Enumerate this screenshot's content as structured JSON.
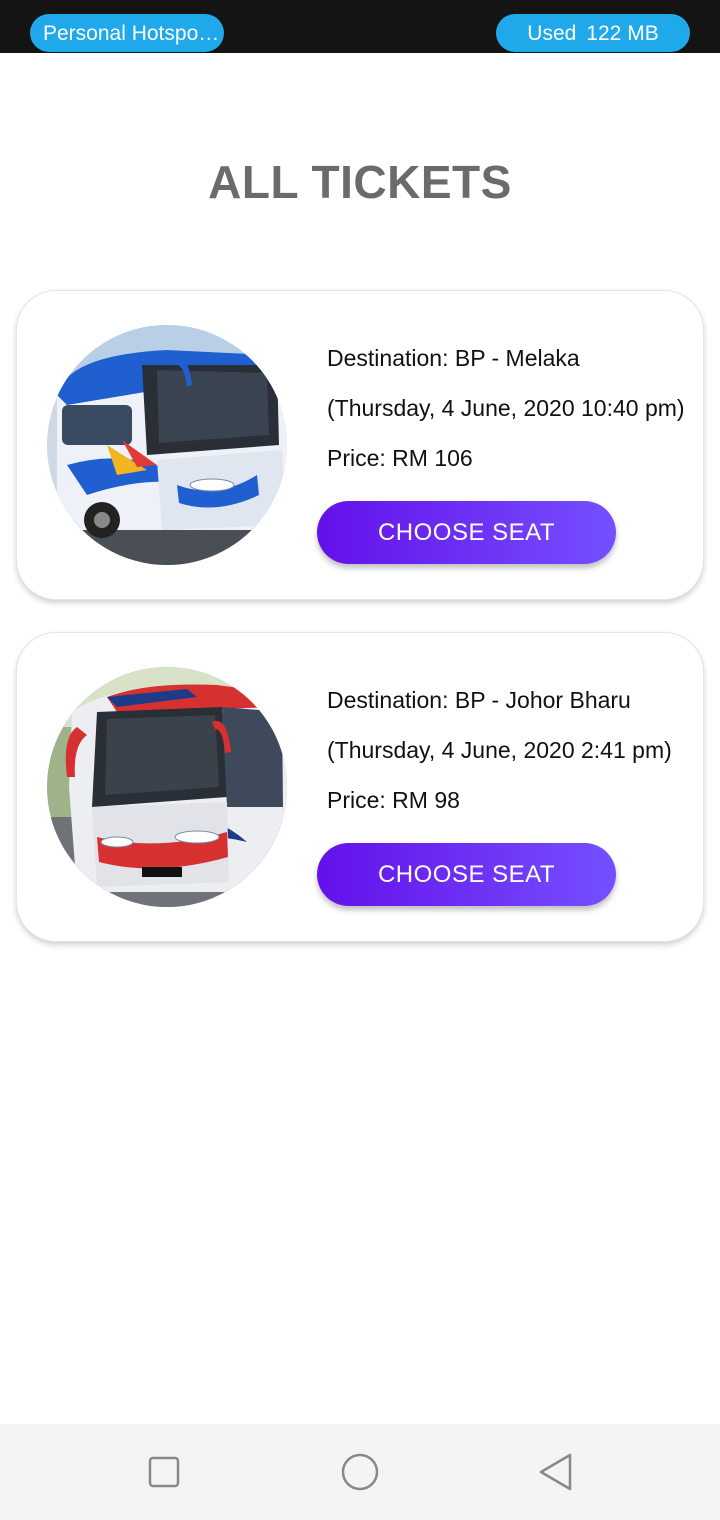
{
  "status_bar": {
    "hotspot_label": "Personal Hotspo…",
    "data_used_label": "Used",
    "data_used_value": "122 MB",
    "pill_color": "#1fa8ea"
  },
  "page": {
    "title": "ALL TICKETS"
  },
  "tickets": [
    {
      "destination": "Destination: BP - Melaka",
      "datetime": "(Thursday, 4 June, 2020 10:40 pm)",
      "price": "Price: RM 106",
      "button_label": "CHOOSE SEAT",
      "bus_colors": [
        "#1f5fd0",
        "#e9eef5"
      ]
    },
    {
      "destination": "Destination: BP - Johor Bharu",
      "datetime": "(Thursday, 4 June, 2020 2:41 pm)",
      "price": "Price: RM 98",
      "button_label": "CHOOSE SEAT",
      "bus_colors": [
        "#d63030",
        "#e6e8ee"
      ]
    }
  ],
  "nav_bar": {
    "icons": [
      "square-recents-icon",
      "circle-home-icon",
      "triangle-back-icon"
    ]
  },
  "colors": {
    "accent_start": "#6410ea",
    "accent_end": "#7550ff",
    "title": "#6b6b6b"
  }
}
